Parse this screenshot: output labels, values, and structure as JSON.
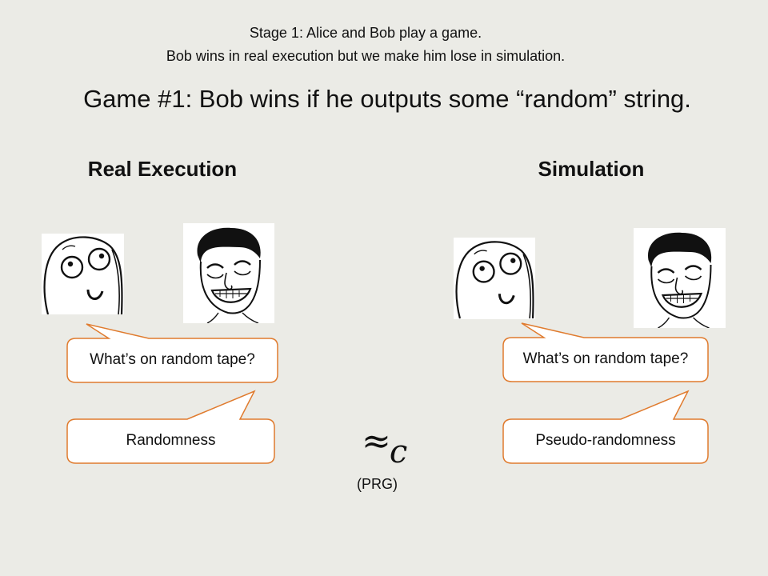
{
  "slide": {
    "stage_line_1": "Stage 1: Alice and Bob play a game.",
    "stage_line_2": "Bob wins in real execution but we make him lose in simulation.",
    "game_title": "Game #1: Bob wins if he outputs some “random” string.",
    "approx_symbol": "≈",
    "approx_subscript": "c",
    "prg_label": "(PRG)"
  },
  "real_execution": {
    "heading": "Real Execution",
    "question": "What’s on random tape?",
    "answer": "Randomness"
  },
  "simulation": {
    "heading": "Simulation",
    "question": "What’s on random tape?",
    "answer": "Pseudo-randomness"
  },
  "colors": {
    "background": "#ebebe6",
    "bubble_border": "#e07b2e",
    "bubble_fill": "#ffffff",
    "text": "#111111"
  },
  "icons": {
    "alice": "alice-rage-face-icon",
    "bob": "bob-laughing-face-icon"
  }
}
